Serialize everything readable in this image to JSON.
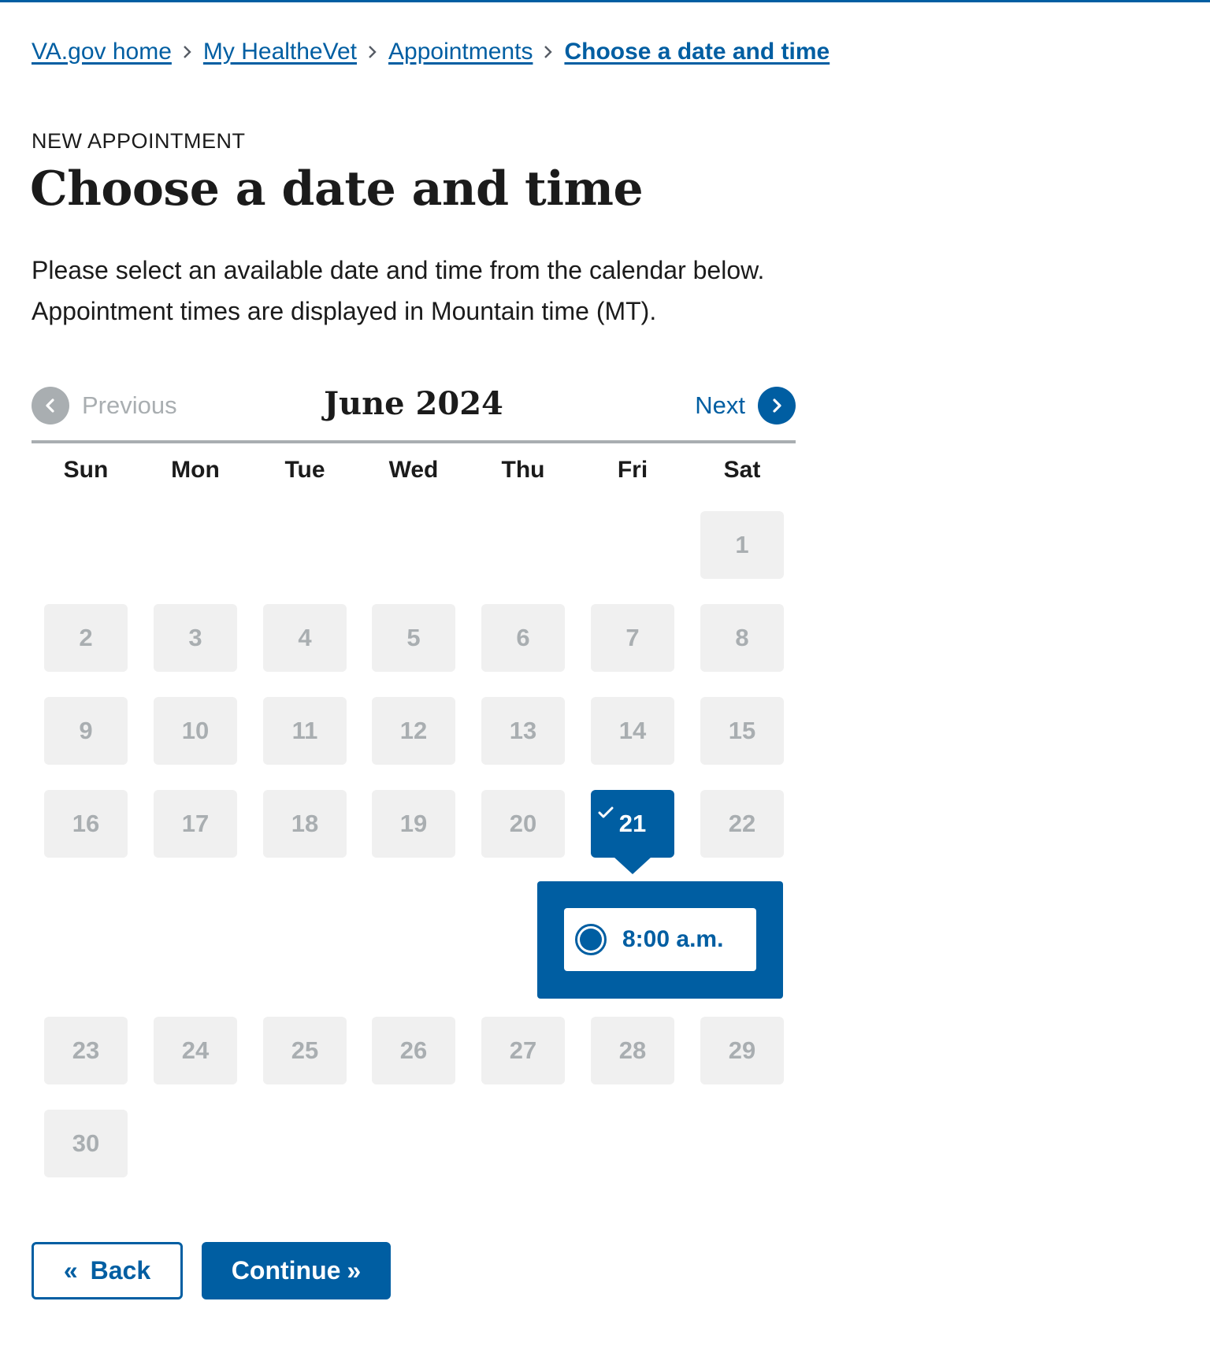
{
  "breadcrumb": {
    "items": [
      {
        "label": "VA.gov home"
      },
      {
        "label": "My HealtheVet"
      },
      {
        "label": "Appointments"
      },
      {
        "label": "Choose a date and time",
        "current": true
      }
    ]
  },
  "header": {
    "eyebrow": "NEW APPOINTMENT",
    "title": "Choose a date and time",
    "description_line1": "Please select an available date and time from the calendar below.",
    "description_line2": "Appointment times are displayed in Mountain time (MT)."
  },
  "calendar": {
    "month_label": "June 2024",
    "prev_label": "Previous",
    "prev_icon": "chevron-left-icon",
    "prev_disabled": true,
    "next_label": "Next",
    "next_icon": "chevron-right-icon",
    "weekdays": [
      "Sun",
      "Mon",
      "Tue",
      "Wed",
      "Thu",
      "Fri",
      "Sat"
    ],
    "days": [
      "1",
      "2",
      "3",
      "4",
      "5",
      "6",
      "7",
      "8",
      "9",
      "10",
      "11",
      "12",
      "13",
      "14",
      "15",
      "16",
      "17",
      "18",
      "19",
      "20",
      "21",
      "22",
      "23",
      "24",
      "25",
      "26",
      "27",
      "28",
      "29",
      "30"
    ],
    "selected_day": "21",
    "selected_icon": "check-icon",
    "time_slots": [
      {
        "label": "8:00 a.m.",
        "selected": true
      }
    ]
  },
  "actions": {
    "back_label": "Back",
    "back_icon": "«",
    "continue_label": "Continue",
    "continue_icon": "»"
  },
  "colors": {
    "primary": "#005ea2",
    "disabled_text": "#a9aeb1",
    "day_bg": "#f0f0f0",
    "text": "#1b1b1b"
  }
}
